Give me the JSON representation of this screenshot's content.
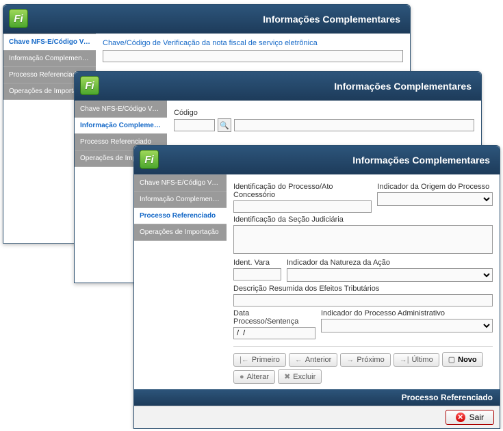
{
  "common": {
    "title": "Informações Complementares",
    "sidebar": {
      "chave": "Chave NFS-E/Código Verificação",
      "info": "Informação Complementar da NF",
      "processo": "Processo Referenciado",
      "operacoes": "Operações de Importação"
    },
    "buttons": {
      "primeiro": "Primeiro",
      "anterior": "Anterior",
      "proximo": "Próximo",
      "ultimo": "Último",
      "novo": "Novo",
      "alterar": "Alterar",
      "excluir": "Excluir",
      "sair": "Sair"
    }
  },
  "win1": {
    "field_label": "Chave/Código de Verificação da nota fiscal de serviço eletrônica"
  },
  "win2": {
    "codigo_label": "Código"
  },
  "win3": {
    "labels": {
      "ident_processo": "Identificação do Processo/Ato Concessório",
      "origem": "Indicador da Origem do Processo",
      "secao": "Identificação da Seção Judiciária",
      "ident_vara": "Ident. Vara",
      "natureza": "Indicador da Natureza da Ação",
      "descricao": "Descrição Resumida dos Efeitos Tributários",
      "data": "Data Processo/Sentença",
      "admin": "Indicador do Processo Administrativo"
    },
    "date_value": "/  /",
    "footer": "Processo Referenciado"
  }
}
